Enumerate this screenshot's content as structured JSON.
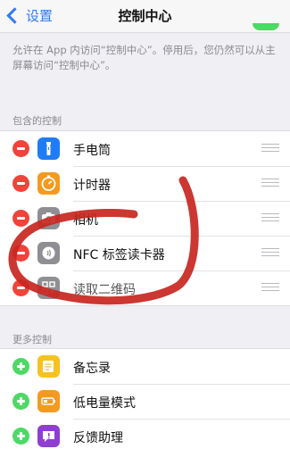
{
  "nav": {
    "back_label": "设置",
    "title": "控制中心"
  },
  "description": "允许在 App 内访问“控制中心”。停用后，您仍然可以从主屏幕访问“控制中心”。",
  "included": {
    "header": "包含的控制",
    "items": [
      {
        "label": "手电筒",
        "icon": "flashlight-icon",
        "icon_color": "#1f7cf5"
      },
      {
        "label": "计时器",
        "icon": "timer-icon",
        "icon_color": "#f49a20"
      },
      {
        "label": "相机",
        "icon": "camera-icon",
        "icon_color": "#8e8e93"
      },
      {
        "label": "NFC 标签读卡器",
        "icon": "nfc-icon",
        "icon_color": "#8e8e93"
      },
      {
        "label": "读取二维码",
        "icon": "qr-code-icon",
        "icon_color": "#8e8e93"
      }
    ]
  },
  "more": {
    "header": "更多控制",
    "items": [
      {
        "label": "备忘录",
        "icon": "notes-icon",
        "icon_color": "#f6c21c"
      },
      {
        "label": "低电量模式",
        "icon": "battery-icon",
        "icon_color": "#f49a20"
      },
      {
        "label": "反馈助理",
        "icon": "feedback-icon",
        "icon_color": "#8e3fd1"
      }
    ]
  },
  "colors": {
    "accent": "#2f7cf6",
    "remove": "#f0433a",
    "add": "#4cd964",
    "annotation": "#c8261f"
  }
}
